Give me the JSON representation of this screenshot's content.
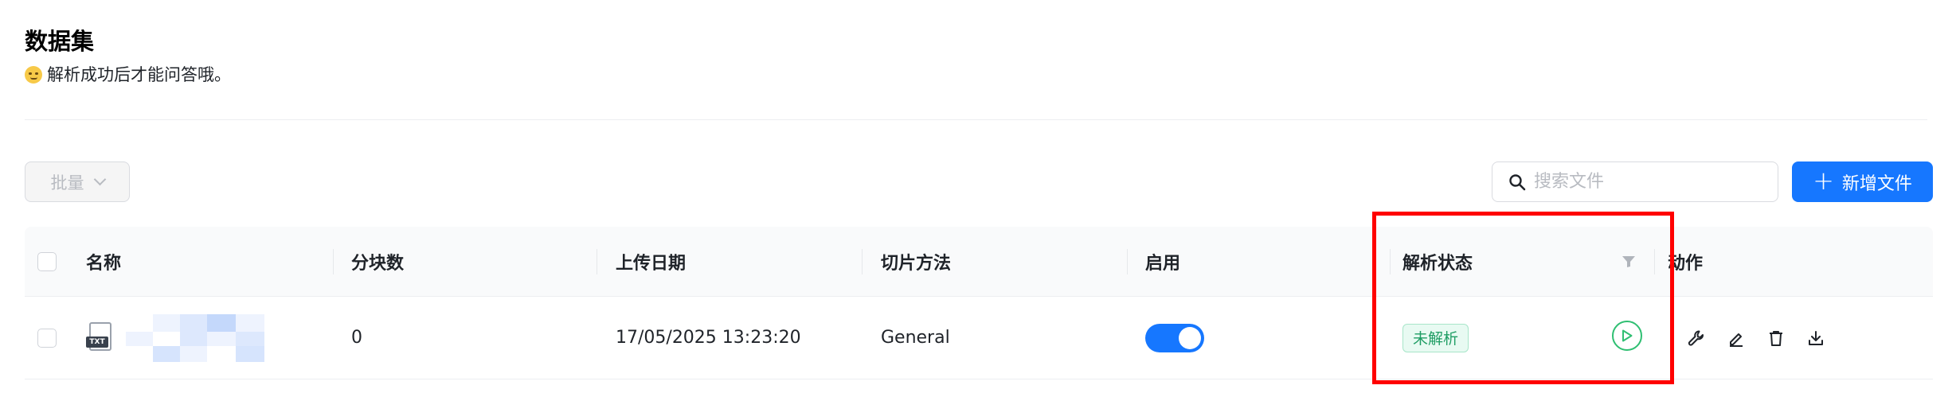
{
  "header": {
    "title": "数据集",
    "subtitle": "解析成功后才能问答哦。",
    "emoji_icon": "smirk-emoji-icon"
  },
  "toolbar": {
    "batch_label": "批量",
    "search_placeholder": "搜索文件",
    "add_label": "新增文件"
  },
  "table": {
    "columns": [
      "名称",
      "分块数",
      "上传日期",
      "切片方法",
      "启用",
      "解析状态",
      "动作"
    ],
    "rows": [
      {
        "file_type": "TXT",
        "name": "",
        "chunks": "0",
        "upload_date": "17/05/2025 13:23:20",
        "slice_method": "General",
        "enabled": true,
        "parse_status": "未解析"
      }
    ]
  },
  "colors": {
    "accent": "#1677ff",
    "status_green": "#1f9d64",
    "highlight_red": "#ff0000"
  }
}
